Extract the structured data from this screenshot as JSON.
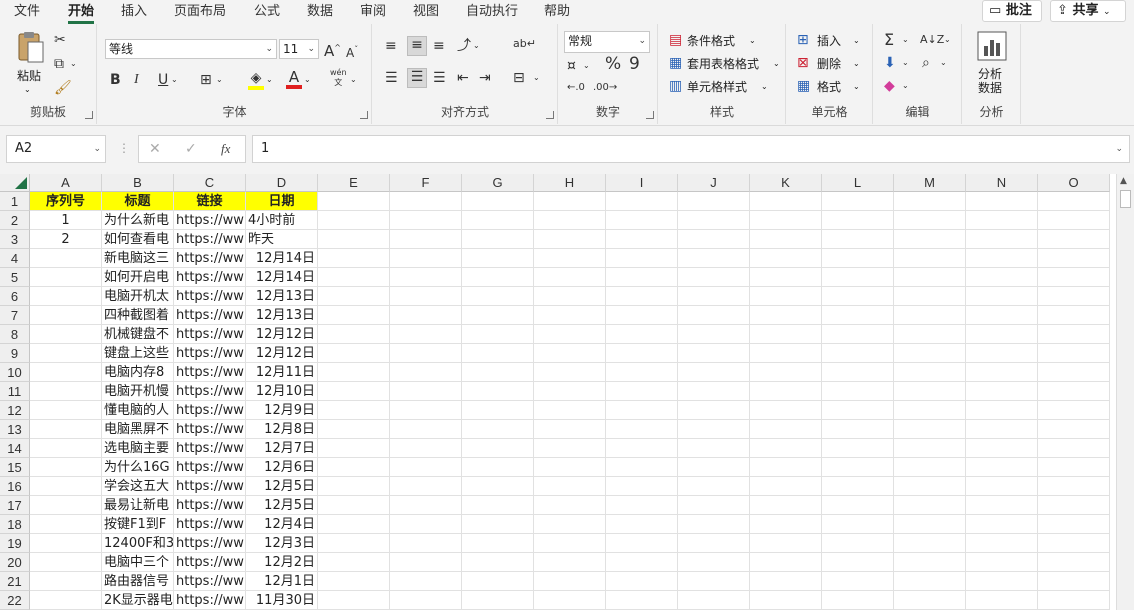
{
  "tabs": [
    "文件",
    "开始",
    "插入",
    "页面布局",
    "公式",
    "数据",
    "审阅",
    "视图",
    "自动执行",
    "帮助"
  ],
  "top_buttons": {
    "comment": "批注",
    "share": "共享"
  },
  "ribbon": {
    "clipboard": {
      "paste": "粘贴",
      "label": "剪贴板"
    },
    "font": {
      "name": "等线",
      "size": "11",
      "bold": "B",
      "italic": "I",
      "underline": "U",
      "label": "字体",
      "grow": "A",
      "shrink": "A",
      "phonetic": "wén"
    },
    "alignment": {
      "label": "对齐方式"
    },
    "number": {
      "format": "常规",
      "percent": "%",
      "comma": "9",
      "label": "数字"
    },
    "styles": {
      "conditional": "条件格式",
      "table": "套用表格格式",
      "cell": "单元格样式",
      "label": "样式"
    },
    "cells": {
      "insert": "插入",
      "delete": "删除",
      "format": "格式",
      "label": "单元格"
    },
    "editing": {
      "label": "编辑"
    },
    "analysis": {
      "button": "分析\n数据",
      "btn1": "分析",
      "btn2": "数据",
      "label": "分析"
    }
  },
  "formula_bar": {
    "name_box": "A2",
    "fx": "fx",
    "value": "1"
  },
  "columns": [
    "A",
    "B",
    "C",
    "D",
    "E",
    "F",
    "G",
    "H",
    "I",
    "J",
    "K",
    "L",
    "M",
    "N",
    "O"
  ],
  "header_row": {
    "A": "序列号",
    "B": "标题",
    "C": "链接",
    "D": "日期"
  },
  "rows": [
    {
      "n": "2",
      "A": "1",
      "B": "为什么新电",
      "C": "https://ww",
      "D": "4小时前",
      "d_align": "left"
    },
    {
      "n": "3",
      "A": "2",
      "B": "如何查看电",
      "C": "https://ww",
      "D": "昨天",
      "d_align": "left"
    },
    {
      "n": "4",
      "A": "",
      "B": "新电脑这三",
      "C": "https://ww",
      "D": "12月14日"
    },
    {
      "n": "5",
      "A": "",
      "B": "如何开启电",
      "C": "https://ww",
      "D": "12月14日"
    },
    {
      "n": "6",
      "A": "",
      "B": "电脑开机太",
      "C": "https://ww",
      "D": "12月13日"
    },
    {
      "n": "7",
      "A": "",
      "B": "四种截图着",
      "C": "https://ww",
      "D": "12月13日"
    },
    {
      "n": "8",
      "A": "",
      "B": "机械键盘不",
      "C": "https://ww",
      "D": "12月12日"
    },
    {
      "n": "9",
      "A": "",
      "B": "键盘上这些",
      "C": "https://ww",
      "D": "12月12日"
    },
    {
      "n": "10",
      "A": "",
      "B": "电脑内存8",
      "C": "https://ww",
      "D": "12月11日"
    },
    {
      "n": "11",
      "A": "",
      "B": "电脑开机慢",
      "C": "https://ww",
      "D": "12月10日"
    },
    {
      "n": "12",
      "A": "",
      "B": "懂电脑的人",
      "C": "https://ww",
      "D": "12月9日"
    },
    {
      "n": "13",
      "A": "",
      "B": "电脑黑屏不",
      "C": "https://ww",
      "D": "12月8日"
    },
    {
      "n": "14",
      "A": "",
      "B": "选电脑主要",
      "C": "https://ww",
      "D": "12月7日"
    },
    {
      "n": "15",
      "A": "",
      "B": "为什么16G",
      "C": "https://ww",
      "D": "12月6日"
    },
    {
      "n": "16",
      "A": "",
      "B": "学会这五大",
      "C": "https://ww",
      "D": "12月5日"
    },
    {
      "n": "17",
      "A": "",
      "B": "最易让新电",
      "C": "https://ww",
      "D": "12月5日"
    },
    {
      "n": "18",
      "A": "",
      "B": "按键F1到F",
      "C": "https://ww",
      "D": "12月4日"
    },
    {
      "n": "19",
      "A": "",
      "B": "12400F和3",
      "C": "https://ww",
      "D": "12月3日"
    },
    {
      "n": "20",
      "A": "",
      "B": "电脑中三个",
      "C": "https://ww",
      "D": "12月2日"
    },
    {
      "n": "21",
      "A": "",
      "B": "路由器信号",
      "C": "https://ww",
      "D": "12月1日"
    },
    {
      "n": "22",
      "A": "",
      "B": "2K显示器电",
      "C": "https://ww",
      "D": "11月30日"
    }
  ],
  "colors": {
    "header_fill": "#ffff00",
    "accent": "#217346"
  }
}
